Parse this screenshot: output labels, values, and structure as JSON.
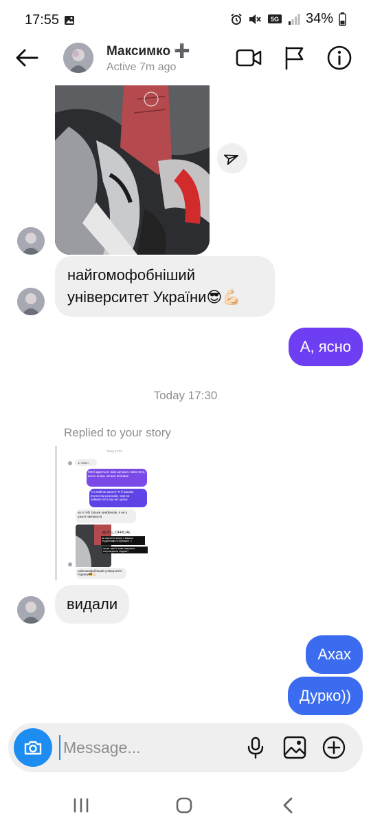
{
  "status_bar": {
    "time": "17:55",
    "battery": "34%",
    "network": "5G"
  },
  "header": {
    "contact_name": "Максимко ➕",
    "presence": "Active 7m ago"
  },
  "messages": {
    "received_1": "найгомофобніший університет України😎💪🏻",
    "sent_1": "А, ясно",
    "timestamp": "Today 17:30",
    "replied_label": "Replied to your story",
    "received_2": "видали",
    "sent_2": "Ахах",
    "sent_3": "Дурко))"
  },
  "story_preview": {
    "time": "Today 17:07",
    "video_label": "▸ Video",
    "msg_1": "Мені здається, вам ще рано пиво пити, воно на вас погано впливає",
    "msg_2": "А в якій ви школі? Я б вашим вчителям розповів, чим ви займаєтеся під час уроку",
    "msg_3": "ну я тобі трішки прибрехав, я не у школі навчаюся)",
    "tag": "@UCU_OFFICIAL",
    "caption_1": "ви маєтете змогу з вашим студентами в принципі :)",
    "caption_2": "чи ви там їх самі навчаєте погрожувати людям?",
    "msg_4": "найгомофобніший університет України😎💪🏻"
  },
  "composer": {
    "placeholder": "Message..."
  },
  "colors": {
    "sent_purple": "#6e3ff2",
    "sent_blue": "#3b6cf0",
    "received_gray": "#efefef",
    "camera_blue": "#1d8df2"
  },
  "icons": [
    "back-arrow-icon",
    "video-call-icon",
    "flag-icon",
    "info-icon",
    "share-icon",
    "camera-icon",
    "microphone-icon",
    "gallery-icon",
    "plus-icon",
    "recent-apps-icon",
    "home-icon",
    "back-icon"
  ]
}
